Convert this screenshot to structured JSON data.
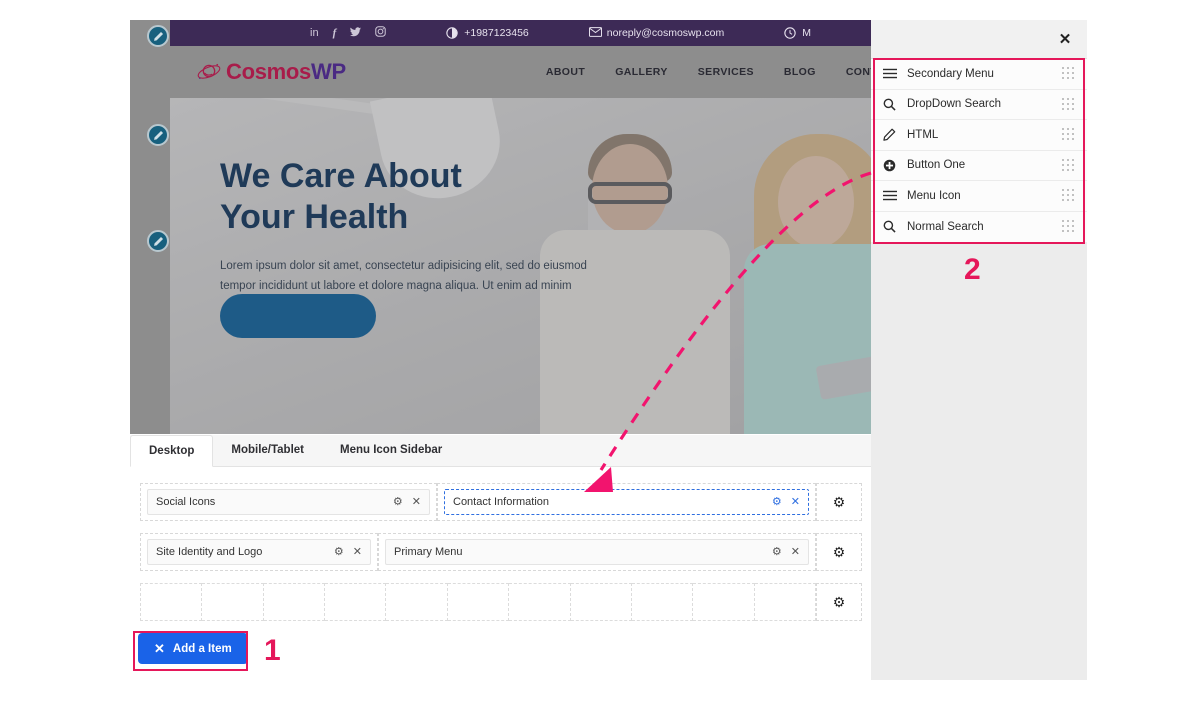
{
  "preview": {
    "topbar": {
      "social_icons": [
        "linkedin-icon",
        "facebook-icon",
        "twitter-icon",
        "instagram-icon"
      ],
      "phone_icon": "half-circle-icon",
      "phone": "+1987123456",
      "email_icon": "envelope-icon",
      "email": "noreply@cosmoswp.com",
      "hours_icon": "clock-icon",
      "hours": "M"
    },
    "brand": {
      "part1": "Cosmos",
      "part2": "WP"
    },
    "nav": [
      "ABOUT",
      "GALLERY",
      "SERVICES",
      "BLOG",
      "CONTA"
    ],
    "hero": {
      "title_line1": "We Care About",
      "title_line2": "Your Health",
      "paragraph": "Lorem ipsum dolor sit amet, consectetur adipisicing elit, sed do eiusmod tempor incididunt ut labore et dolore magna aliqua. Ut enim ad minim"
    },
    "edit_icons": [
      "pencil-edit-icon",
      "pencil-edit-icon",
      "pencil-edit-icon"
    ]
  },
  "builder": {
    "tabs": [
      {
        "label": "Desktop",
        "active": true
      },
      {
        "label": "Mobile/Tablet",
        "active": false
      },
      {
        "label": "Menu Icon Sidebar",
        "active": false
      }
    ],
    "rows": [
      {
        "widgets": [
          {
            "label": "Social Icons",
            "selected": false
          },
          {
            "label": "Contact Information",
            "selected": true
          }
        ]
      },
      {
        "widgets": [
          {
            "label": "Site Identity and Logo",
            "selected": false
          },
          {
            "label": "Primary Menu",
            "selected": false
          }
        ]
      }
    ],
    "empty_row_cells": 11,
    "row_gear_icon": "gear-icon",
    "widget_gear_icon": "gear-icon",
    "widget_remove_icon": "close-x-icon",
    "add_button": {
      "icon": "plus-icon",
      "label": "Add a Item"
    }
  },
  "side_panel": {
    "close_icon": "close-x-icon",
    "items": [
      {
        "icon": "hamburger-menu-icon",
        "label": "Secondary Menu",
        "handle": "drag-handle-icon"
      },
      {
        "icon": "search-icon",
        "label": "DropDown Search",
        "handle": "drag-handle-icon"
      },
      {
        "icon": "pencil-icon",
        "label": "HTML",
        "handle": "drag-handle-icon"
      },
      {
        "icon": "plus-circle-icon",
        "label": "Button One",
        "handle": "drag-handle-icon"
      },
      {
        "icon": "hamburger-menu-icon",
        "label": "Menu Icon",
        "handle": "drag-handle-icon"
      },
      {
        "icon": "search-icon",
        "label": "Normal Search",
        "handle": "drag-handle-icon"
      }
    ]
  },
  "annotations": {
    "marker_one": "1",
    "marker_two": "2",
    "highlight_color": "#e5175a",
    "arrow_color": "#f2146e"
  },
  "colors": {
    "accent_blue": "#1a63e8",
    "brand_crimson": "#a81c4a",
    "brand_purple": "#4a2a83",
    "topbar_purple": "#3d2a56",
    "hero_title": "#1f3a58",
    "selected_blue": "#2f6fe0"
  }
}
